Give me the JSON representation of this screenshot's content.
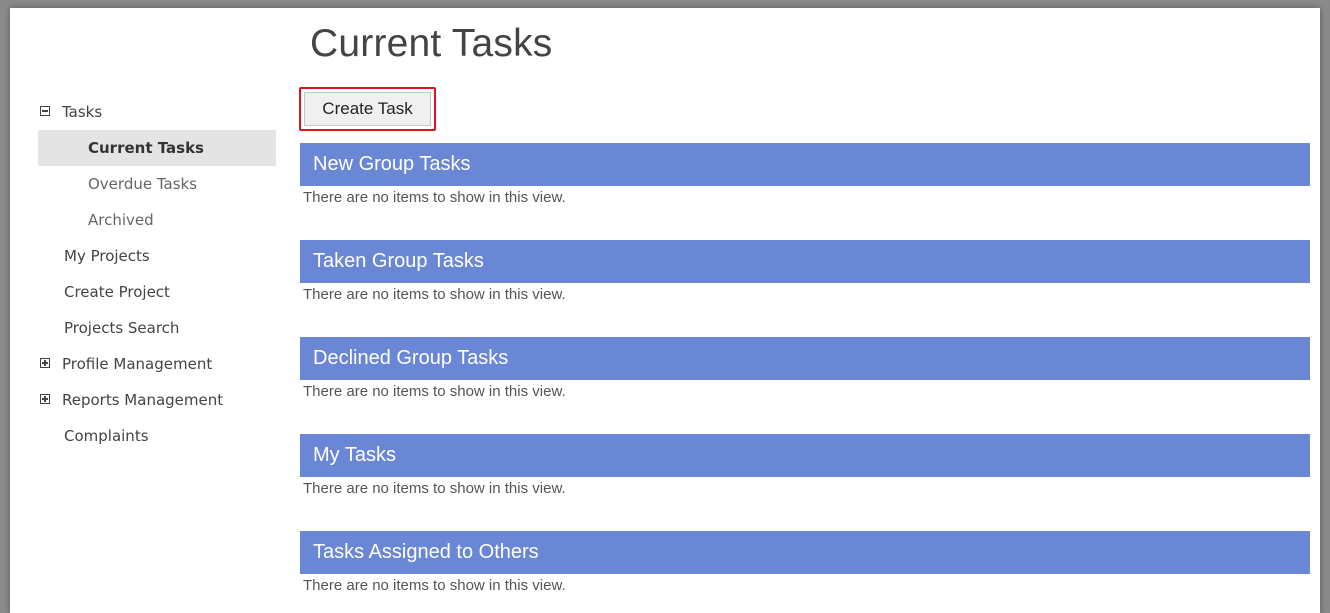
{
  "page": {
    "title": "Current Tasks"
  },
  "toolbar": {
    "create_label": "Create Task"
  },
  "sidebar": {
    "items": [
      {
        "label": "Tasks"
      },
      {
        "label": "Current Tasks"
      },
      {
        "label": "Overdue Tasks"
      },
      {
        "label": "Archived"
      },
      {
        "label": "My Projects"
      },
      {
        "label": "Create Project"
      },
      {
        "label": "Projects Search"
      },
      {
        "label": "Profile Management"
      },
      {
        "label": "Reports Management"
      },
      {
        "label": "Complaints"
      }
    ]
  },
  "sections": [
    {
      "title": "New Group Tasks",
      "empty": "There are no items to show in this view."
    },
    {
      "title": "Taken Group Tasks",
      "empty": "There are no items to show in this view."
    },
    {
      "title": "Declined Group Tasks",
      "empty": "There are no items to show in this view."
    },
    {
      "title": "My Tasks",
      "empty": "There are no items to show in this view."
    },
    {
      "title": "Tasks Assigned to Others",
      "empty": "There are no items to show in this view."
    }
  ],
  "colors": {
    "section_header": "#6a87d5",
    "highlight_border": "#e0141c",
    "selected_nav": "#e4e4e4"
  }
}
